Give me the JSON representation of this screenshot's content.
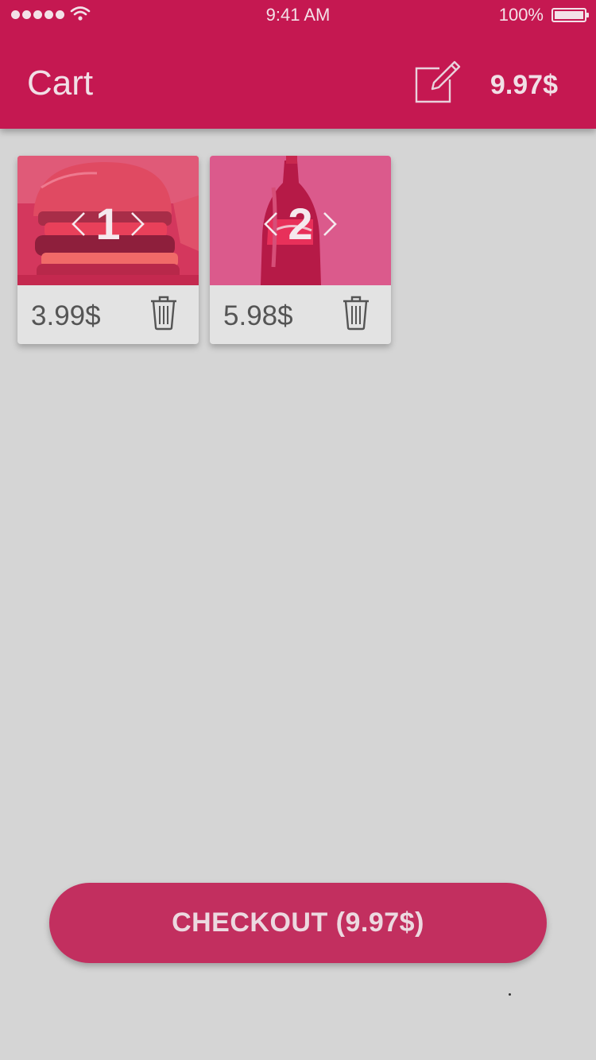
{
  "status_bar": {
    "time": "9:41 AM",
    "battery": "100%"
  },
  "header": {
    "title": "Cart",
    "total": "9.97$"
  },
  "cart_items": [
    {
      "name": "burger",
      "quantity": "1",
      "price": "3.99$"
    },
    {
      "name": "cola",
      "quantity": "2",
      "price": "5.98$"
    }
  ],
  "checkout": {
    "label": "CHECKOUT (9.97$)"
  },
  "colors": {
    "primary": "#c51851",
    "button": "#c22f5f",
    "background": "#d5d5d5",
    "card": "#e3e3e3"
  }
}
